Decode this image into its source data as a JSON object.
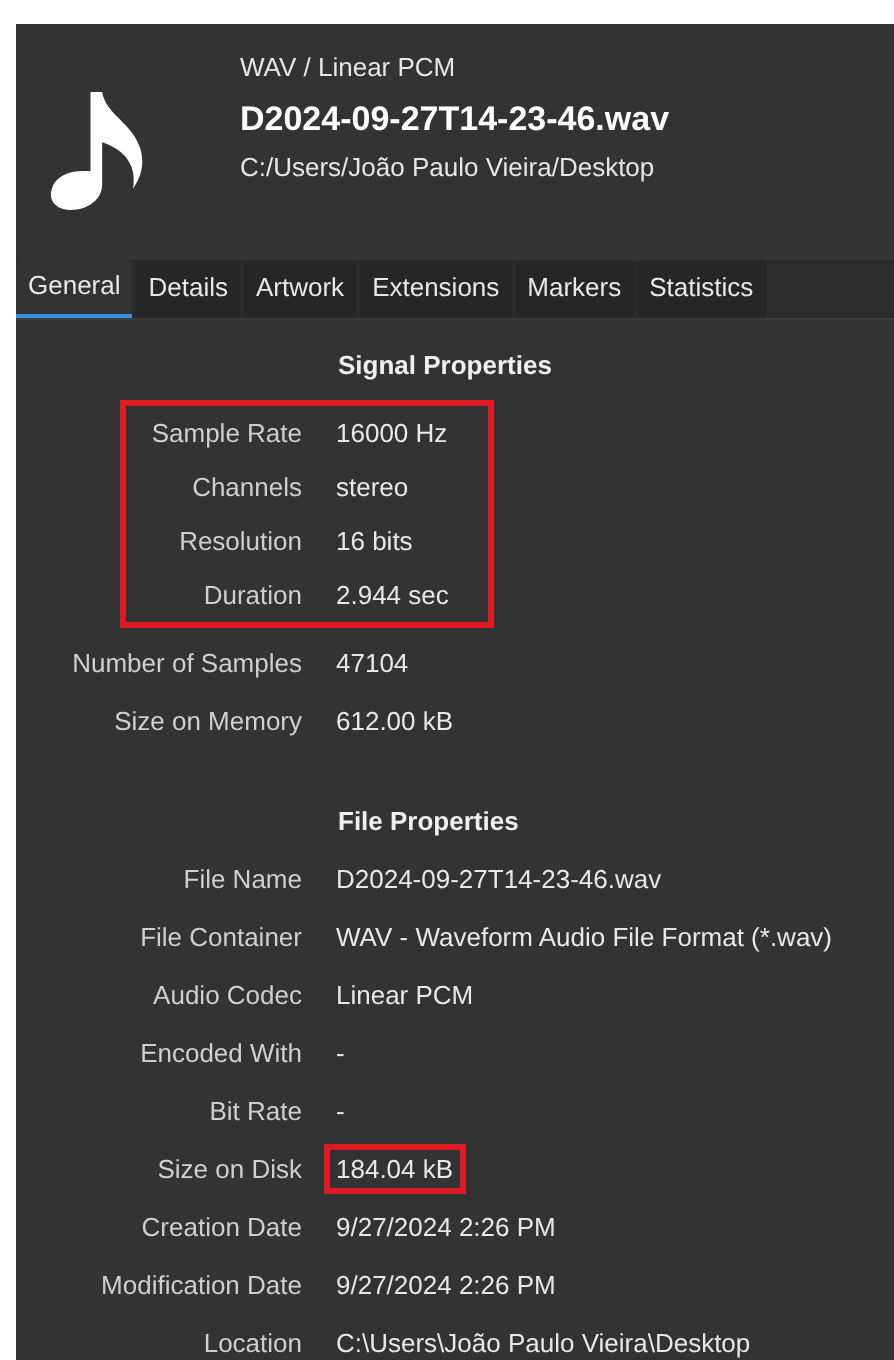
{
  "header": {
    "format": "WAV / Linear PCM",
    "file_name": "D2024-09-27T14-23-46.wav",
    "path": "C:/Users/João Paulo Vieira/Desktop"
  },
  "tabs": [
    {
      "label": "General",
      "selected": true
    },
    {
      "label": "Details",
      "selected": false
    },
    {
      "label": "Artwork",
      "selected": false
    },
    {
      "label": "Extensions",
      "selected": false
    },
    {
      "label": "Markers",
      "selected": false
    },
    {
      "label": "Statistics",
      "selected": false
    }
  ],
  "sections": [
    {
      "title": "Signal Properties",
      "items": [
        {
          "kind": "highlight-group",
          "rows": [
            {
              "label": "Sample Rate",
              "value": "16000 Hz",
              "value_highlighted": false
            },
            {
              "label": "Channels",
              "value": "stereo",
              "value_highlighted": false
            },
            {
              "label": "Resolution",
              "value": "16 bits",
              "value_highlighted": false
            },
            {
              "label": "Duration",
              "value": "2.944 sec",
              "value_highlighted": false
            }
          ]
        },
        {
          "kind": "row",
          "label": "Number of Samples",
          "value": "47104",
          "value_highlighted": false
        },
        {
          "kind": "row",
          "label": "Size on Memory",
          "value": "612.00 kB",
          "value_highlighted": false
        }
      ]
    },
    {
      "title": "File Properties",
      "items": [
        {
          "kind": "row",
          "label": "File Name",
          "value": "D2024-09-27T14-23-46.wav",
          "value_highlighted": false
        },
        {
          "kind": "row",
          "label": "File Container",
          "value": "WAV - Waveform Audio File Format (*.wav)",
          "value_highlighted": false
        },
        {
          "kind": "row",
          "label": "Audio Codec",
          "value": "Linear PCM",
          "value_highlighted": false
        },
        {
          "kind": "row",
          "label": "Encoded With",
          "value": "-",
          "value_highlighted": false
        },
        {
          "kind": "row",
          "label": "Bit Rate",
          "value": "-",
          "value_highlighted": false
        },
        {
          "kind": "row",
          "label": "Size on Disk",
          "value": "184.04 kB",
          "value_highlighted": true
        },
        {
          "kind": "row",
          "label": "Creation Date",
          "value": "9/27/2024 2:26 PM",
          "value_highlighted": false
        },
        {
          "kind": "row",
          "label": "Modification Date",
          "value": "9/27/2024 2:26 PM",
          "value_highlighted": false
        },
        {
          "kind": "row",
          "label": "Location",
          "value": "C:\\Users\\João Paulo Vieira\\Desktop",
          "value_highlighted": false
        }
      ]
    }
  ]
}
